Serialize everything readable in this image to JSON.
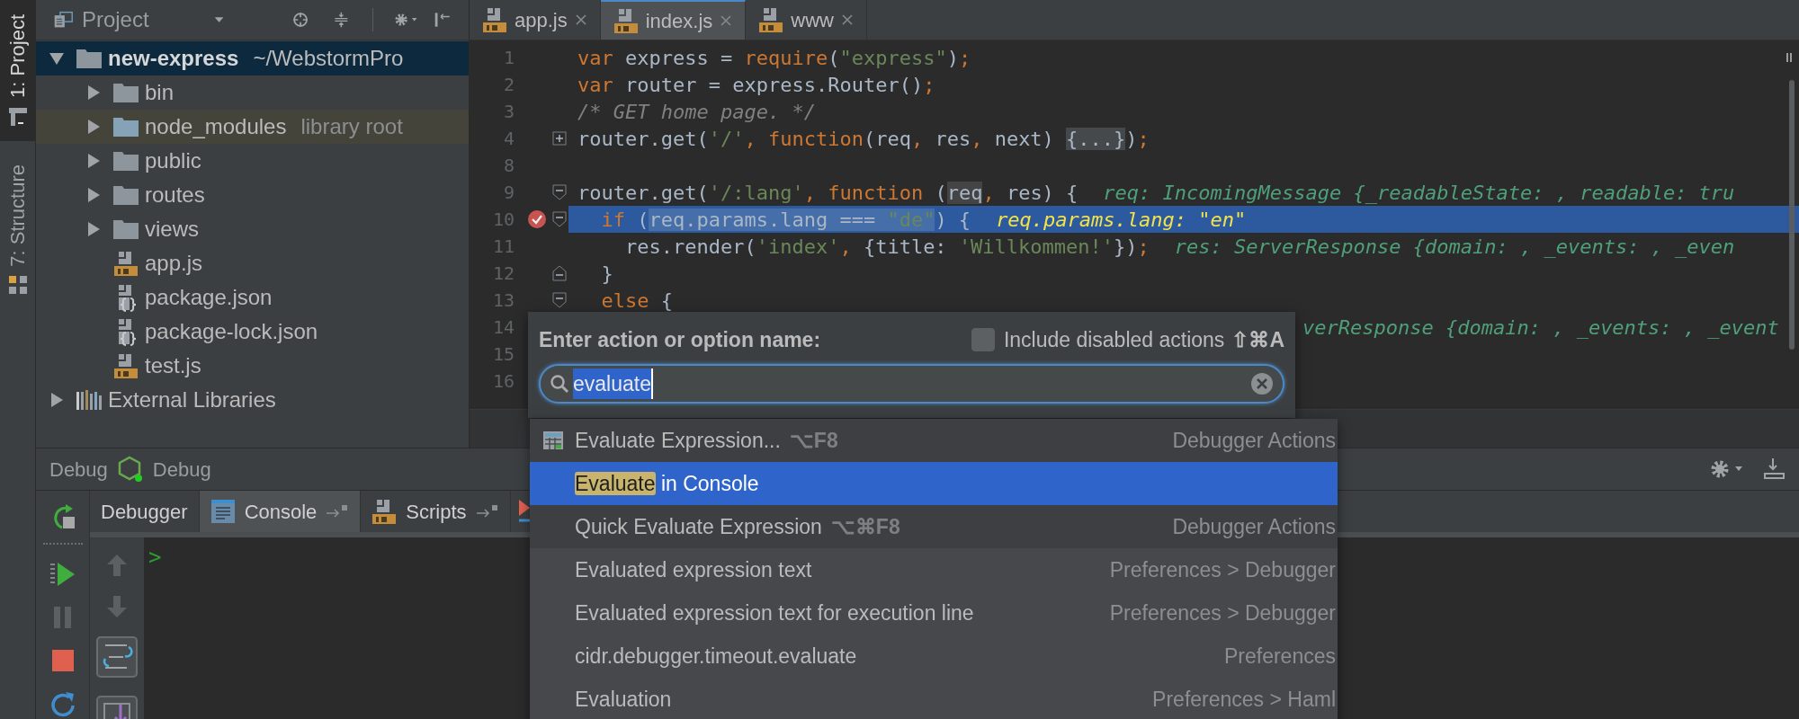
{
  "tool_strip": [
    {
      "label": "1: Project",
      "selected": true,
      "kind": "project"
    },
    {
      "label": "7: Structure",
      "selected": false,
      "kind": "structure"
    }
  ],
  "project_panel": {
    "title": "Project",
    "tree": [
      {
        "name": "new-express",
        "path": "~/WebstormPro",
        "kind": "folder",
        "expanded": true,
        "selected": true,
        "children": [
          {
            "name": "bin",
            "kind": "folder",
            "expanded": false,
            "selected": false
          },
          {
            "name": "node_modules",
            "note": "library root",
            "kind": "library",
            "expanded": false,
            "selected": false
          },
          {
            "name": "public",
            "kind": "folder",
            "expanded": false,
            "selected": false
          },
          {
            "name": "routes",
            "kind": "folder",
            "expanded": false,
            "selected": false
          },
          {
            "name": "views",
            "kind": "folder",
            "expanded": false,
            "selected": false
          },
          {
            "name": "app.js",
            "kind": "js",
            "selected": false
          },
          {
            "name": "package.json",
            "kind": "json",
            "selected": false
          },
          {
            "name": "package-lock.json",
            "kind": "json",
            "selected": false
          },
          {
            "name": "test.js",
            "kind": "js",
            "selected": false
          }
        ]
      },
      {
        "name": "External Libraries",
        "kind": "libraries",
        "expanded": false,
        "selected": false
      }
    ]
  },
  "editor": {
    "tabs": [
      {
        "label": "app.js",
        "selected": false
      },
      {
        "label": "index.js",
        "selected": true
      },
      {
        "label": "www",
        "selected": false
      }
    ],
    "lines": [
      {
        "number": "1",
        "kind": "plain",
        "breakpoint": false,
        "current": false,
        "code": [
          {
            "kind": "kw",
            "text": "var"
          },
          {
            "kind": "plain",
            "text": " express = "
          },
          {
            "kind": "kw",
            "text": "require"
          },
          {
            "kind": "plain",
            "text": "("
          },
          {
            "kind": "str",
            "text": "\"express\""
          },
          {
            "kind": "plain",
            "text": ")"
          },
          {
            "kind": "kw",
            "text": ";"
          }
        ]
      },
      {
        "number": "2",
        "kind": "plain",
        "breakpoint": false,
        "current": false,
        "code": [
          {
            "kind": "kw",
            "text": "var"
          },
          {
            "kind": "plain",
            "text": " router = express.Router()"
          },
          {
            "kind": "kw",
            "text": ";"
          }
        ]
      },
      {
        "number": "3",
        "kind": "plain",
        "breakpoint": false,
        "current": false,
        "code": [
          {
            "kind": "comment",
            "text": "/* GET home page. */"
          }
        ]
      },
      {
        "number": "4",
        "kind": "fold-collapsed",
        "breakpoint": false,
        "current": false,
        "code": [
          {
            "kind": "plain",
            "text": "router.get("
          },
          {
            "kind": "str",
            "text": "'/'"
          },
          {
            "kind": "kw",
            "text": ", "
          },
          {
            "kind": "kw",
            "text": "function"
          },
          {
            "kind": "plain",
            "text": "(req"
          },
          {
            "kind": "kw",
            "text": ","
          },
          {
            "kind": "plain",
            "text": " res"
          },
          {
            "kind": "kw",
            "text": ","
          },
          {
            "kind": "plain",
            "text": " next) "
          },
          {
            "kind": "fold",
            "text": "{...}"
          },
          {
            "kind": "plain",
            "text": ")"
          },
          {
            "kind": "kw",
            "text": ";"
          }
        ]
      },
      {
        "number": "8",
        "kind": "plain",
        "breakpoint": false,
        "current": false
      },
      {
        "number": "9",
        "kind": "fold-start",
        "breakpoint": false,
        "current": false,
        "code": [
          {
            "kind": "plain",
            "text": "router.get("
          },
          {
            "kind": "str",
            "text": "'/:lang'"
          },
          {
            "kind": "kw",
            "text": ", "
          },
          {
            "kind": "kw",
            "text": "function"
          },
          {
            "kind": "plain",
            "text": " ("
          },
          {
            "kind": "usage",
            "text": "req"
          },
          {
            "kind": "kw",
            "text": ","
          },
          {
            "kind": "plain",
            "text": " res) {"
          }
        ],
        "hint": "req: IncomingMessage {_readableState: , readable: tru"
      },
      {
        "number": "10",
        "kind": "fold-start",
        "breakpoint": true,
        "current": true,
        "code": [
          {
            "kind": "kw",
            "text": "  if"
          },
          {
            "kind": "plain",
            "text": " ("
          },
          {
            "kind": "usage",
            "text": "req.params.lang === "
          },
          {
            "kind": "usage-str",
            "text": "\"de\""
          },
          {
            "kind": "plain",
            "text": ") {"
          }
        ],
        "hint": "req.params.lang: \"en\""
      },
      {
        "number": "11",
        "kind": "plain",
        "breakpoint": false,
        "current": false,
        "code": [
          {
            "kind": "plain",
            "text": "    res.render("
          },
          {
            "kind": "str",
            "text": "'index'"
          },
          {
            "kind": "kw",
            "text": ","
          },
          {
            "kind": "plain",
            "text": " {title: "
          },
          {
            "kind": "str",
            "text": "'Willkommen!'"
          },
          {
            "kind": "plain",
            "text": "})"
          },
          {
            "kind": "kw",
            "text": ";"
          }
        ],
        "hint": "res: ServerResponse {domain: , _events: , _even"
      },
      {
        "number": "12",
        "kind": "fold-end",
        "breakpoint": false,
        "current": false,
        "code": [
          {
            "kind": "plain",
            "text": "  }"
          }
        ]
      },
      {
        "number": "13",
        "kind": "fold-start",
        "breakpoint": false,
        "current": false,
        "code": [
          {
            "kind": "kw",
            "text": "  else"
          },
          {
            "kind": "plain",
            "text": " {"
          }
        ]
      },
      {
        "number": "14",
        "kind": "covered",
        "breakpoint": false,
        "current": false,
        "hint": "verResponse {domain: , _events: , _event"
      },
      {
        "number": "15",
        "kind": "plain",
        "breakpoint": false,
        "current": false
      },
      {
        "number": "16",
        "kind": "plain",
        "breakpoint": false,
        "current": false
      }
    ]
  },
  "debug": {
    "title": "Debug",
    "config": "Debug",
    "tabs": [
      {
        "label": "Debugger",
        "selected": false,
        "kind": "plain"
      },
      {
        "label": "Console",
        "selected": true,
        "kind": "console"
      },
      {
        "label": "Scripts",
        "selected": false,
        "kind": "scripts"
      }
    ],
    "prompt": ">"
  },
  "action_popup": {
    "prompt": "Enter action or option name:",
    "include_disabled": {
      "label": "Include disabled actions",
      "checked": false
    },
    "shortcut": "⇧⌘A",
    "query": "evaluate",
    "results": [
      {
        "kind": "action",
        "selected": false,
        "icon": true,
        "parts": [
          {
            "text": "Evaluate Expression...",
            "match": false
          }
        ],
        "shortcut": "⌥F8",
        "category": "Debugger Actions"
      },
      {
        "kind": "action",
        "selected": true,
        "icon": false,
        "parts": [
          {
            "text": "Evaluate",
            "match": true
          },
          {
            "text": " in Console",
            "match": false
          }
        ]
      },
      {
        "kind": "action",
        "selected": false,
        "icon": false,
        "parts": [
          {
            "text": "Quick Evaluate Expression",
            "match": false
          }
        ],
        "shortcut": "⌥⌘F8",
        "category": "Debugger Actions"
      },
      {
        "kind": "option",
        "selected": false,
        "icon": false,
        "parts": [
          {
            "text": "Evaluated expression text",
            "match": false
          }
        ],
        "category": "Preferences > Debugger"
      },
      {
        "kind": "option",
        "selected": false,
        "icon": false,
        "parts": [
          {
            "text": "Evaluated expression text for execution line",
            "match": false
          }
        ],
        "category": "Preferences > Debugger"
      },
      {
        "kind": "option",
        "selected": false,
        "icon": false,
        "parts": [
          {
            "text": "cidr.debugger.timeout.evaluate",
            "match": false
          }
        ],
        "category": "Preferences"
      },
      {
        "kind": "option",
        "selected": false,
        "icon": false,
        "parts": [
          {
            "text": "Evaluation",
            "match": false
          }
        ],
        "category": "Preferences > Haml"
      }
    ]
  }
}
